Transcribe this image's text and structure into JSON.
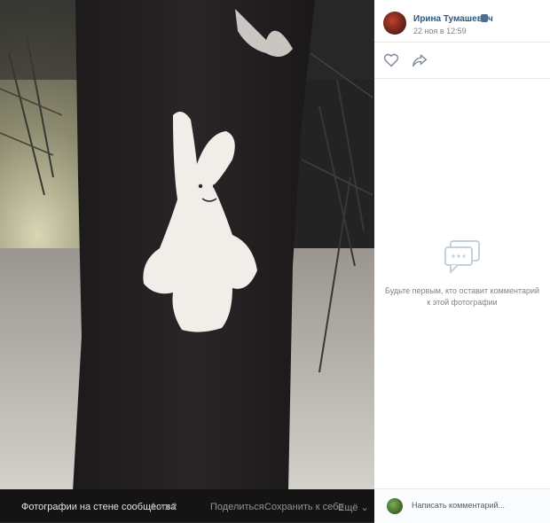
{
  "photo": {
    "alt_subject": "snow-bunny-on-tree"
  },
  "bottom_bar": {
    "album_label": "Фотографии на стене сообщества",
    "counter": "1 из 2",
    "share_label": "Поделиться",
    "save_label": "Сохранить к себе",
    "more_label": "Ещё ⌄"
  },
  "author": {
    "name": "Ирина Тумашевич",
    "date": "22 ноя в 12:59"
  },
  "actions": {
    "like_icon": "heart-outline-icon",
    "share_icon": "share-arrow-icon"
  },
  "comments": {
    "empty_text": "Будьте первым, кто оставит комментарий к этой фотографии",
    "placeholder": "Написать комментарий..."
  },
  "colors": {
    "link": "#2a5885",
    "muted": "#828282",
    "divider": "#e7e8ec"
  }
}
